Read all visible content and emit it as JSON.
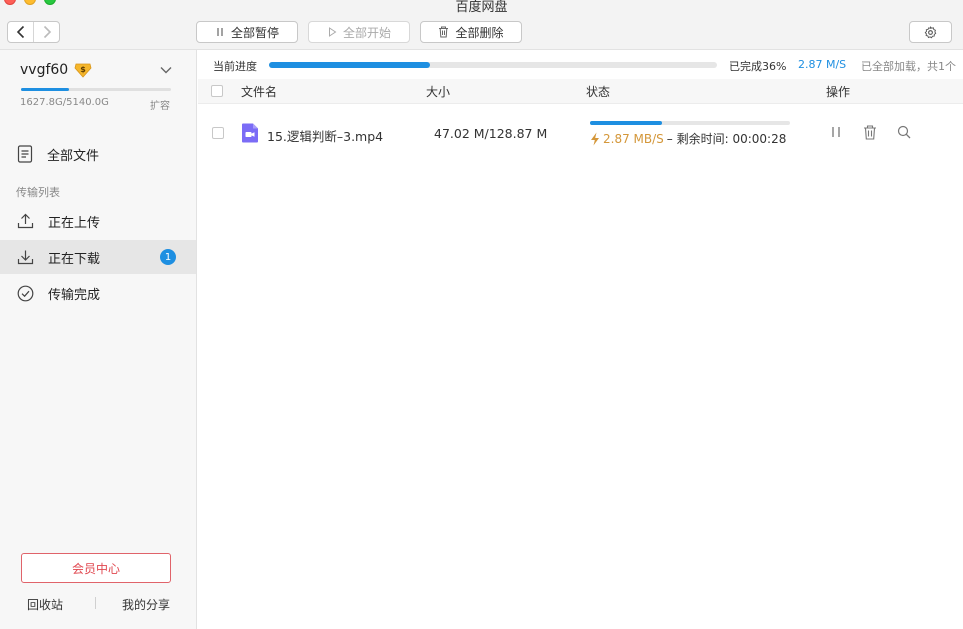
{
  "window": {
    "title": "百度网盘"
  },
  "toolbar": {
    "pause_all": "全部暂停",
    "start_all": "全部开始",
    "delete_all": "全部删除"
  },
  "user": {
    "name": "vvgf60",
    "quota_text": "1627.8G/5140.0G",
    "quota_fraction": 0.32,
    "expand": "扩容"
  },
  "sidebar": {
    "all_files": "全部文件",
    "section_title": "传输列表",
    "uploading": "正在上传",
    "downloading": "正在下载",
    "downloading_count": "1",
    "completed": "传输完成",
    "vip_center": "会员中心",
    "recycle_bin": "回收站",
    "my_share": "我的分享"
  },
  "progress": {
    "label": "当前进度",
    "fraction": 0.36,
    "done_text": "已完成36%",
    "speed": "2.87 M/S",
    "loaded_text": "已全部加载，共1个"
  },
  "table": {
    "columns": {
      "name": "文件名",
      "size": "大小",
      "status": "状态",
      "actions": "操作"
    },
    "rows": [
      {
        "name": "15.逻辑判断–3.mp4",
        "size": "47.02 M/128.87 M",
        "progress_fraction": 0.36,
        "speed": "2.87 MB/S",
        "remaining": "– 剩余时间: 00:00:28",
        "icon": "video-file-icon"
      }
    ]
  },
  "colors": {
    "accent": "#1e8fe1",
    "speed_orange": "#d4973a",
    "vip_red": "#e0474f",
    "video_icon": "#7b6cf6"
  }
}
